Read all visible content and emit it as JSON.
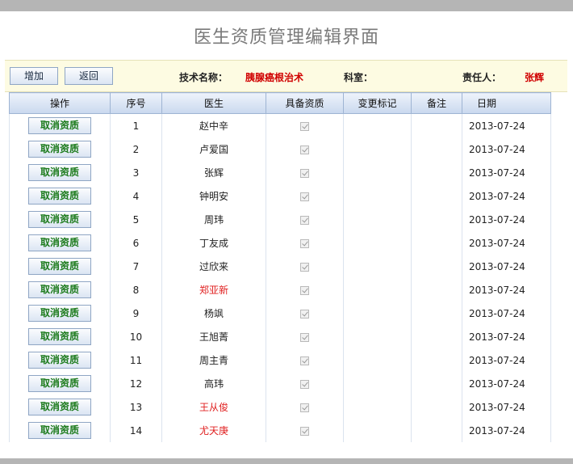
{
  "page": {
    "title": "医生资质管理编辑界面"
  },
  "toolbar": {
    "add_label": "增加",
    "back_label": "返回",
    "tech_label": "技术名称：",
    "tech_value": "胰腺癌根治术",
    "dept_label": "科室：",
    "dept_value": "",
    "owner_label": "责任人：",
    "owner_value": "张辉"
  },
  "table": {
    "headers": [
      "操作",
      "序号",
      "医生",
      "具备资质",
      "变更标记",
      "备注",
      "日期"
    ],
    "action_label": "取消资质",
    "rows": [
      {
        "no": "1",
        "doctor": "赵中辛",
        "highlight": false,
        "qualified": true,
        "change": "",
        "note": "",
        "date": "2013-07-24"
      },
      {
        "no": "2",
        "doctor": "卢爱国",
        "highlight": false,
        "qualified": true,
        "change": "",
        "note": "",
        "date": "2013-07-24"
      },
      {
        "no": "3",
        "doctor": "张辉",
        "highlight": false,
        "qualified": true,
        "change": "",
        "note": "",
        "date": "2013-07-24"
      },
      {
        "no": "4",
        "doctor": "钟明安",
        "highlight": false,
        "qualified": true,
        "change": "",
        "note": "",
        "date": "2013-07-24"
      },
      {
        "no": "5",
        "doctor": "周玮",
        "highlight": false,
        "qualified": true,
        "change": "",
        "note": "",
        "date": "2013-07-24"
      },
      {
        "no": "6",
        "doctor": "丁友成",
        "highlight": false,
        "qualified": true,
        "change": "",
        "note": "",
        "date": "2013-07-24"
      },
      {
        "no": "7",
        "doctor": "过欣来",
        "highlight": false,
        "qualified": true,
        "change": "",
        "note": "",
        "date": "2013-07-24"
      },
      {
        "no": "8",
        "doctor": "郑亚新",
        "highlight": true,
        "qualified": true,
        "change": "",
        "note": "",
        "date": "2013-07-24"
      },
      {
        "no": "9",
        "doctor": "杨飒",
        "highlight": false,
        "qualified": true,
        "change": "",
        "note": "",
        "date": "2013-07-24"
      },
      {
        "no": "10",
        "doctor": "王旭菁",
        "highlight": false,
        "qualified": true,
        "change": "",
        "note": "",
        "date": "2013-07-24"
      },
      {
        "no": "11",
        "doctor": "周主青",
        "highlight": false,
        "qualified": true,
        "change": "",
        "note": "",
        "date": "2013-07-24"
      },
      {
        "no": "12",
        "doctor": "高玮",
        "highlight": false,
        "qualified": true,
        "change": "",
        "note": "",
        "date": "2013-07-24"
      },
      {
        "no": "13",
        "doctor": "王从俊",
        "highlight": true,
        "qualified": true,
        "change": "",
        "note": "",
        "date": "2013-07-24"
      },
      {
        "no": "14",
        "doctor": "尤天庚",
        "highlight": true,
        "qualified": true,
        "change": "",
        "note": "",
        "date": "2013-07-24"
      }
    ]
  },
  "colors": {
    "highlight_name": "#e02020",
    "action_text": "#1b7a1b",
    "toolbar_bg": "#fdfbe2",
    "header_bg": "#c9d8ee"
  }
}
